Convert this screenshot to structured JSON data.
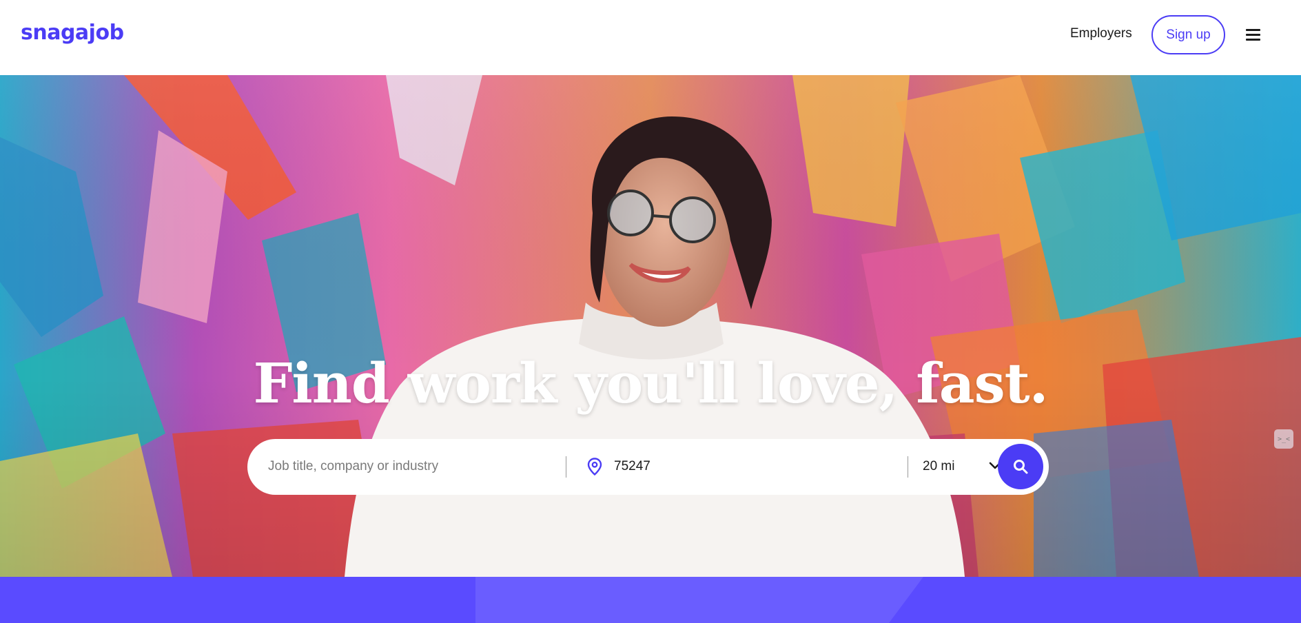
{
  "brand": {
    "name": "snagajob",
    "accent_color": "#4b3cf5"
  },
  "nav": {
    "employers_label": "Employers",
    "signup_label": "Sign up",
    "menu_icon": "hamburger-menu-icon"
  },
  "hero": {
    "title": "Find work you'll love, fast.",
    "search": {
      "job_placeholder": "Job title, company or industry",
      "job_value": "",
      "location_icon": "map-pin-icon",
      "location_value": "75247",
      "radius_value": "20 mi",
      "search_icon": "search-icon"
    },
    "devtool_badge": ">_<"
  }
}
